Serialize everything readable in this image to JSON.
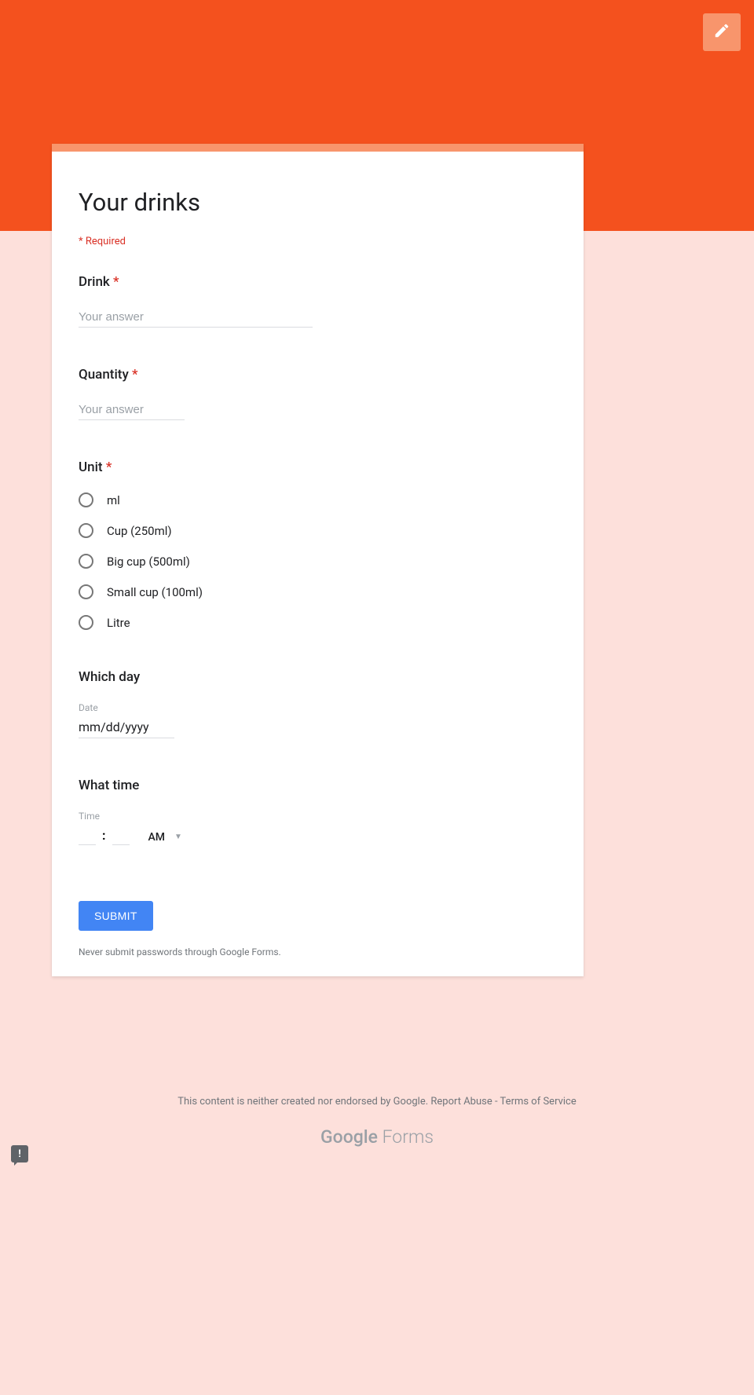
{
  "form": {
    "title": "Your drinks",
    "required_legend": "* Required",
    "questions": {
      "drink": {
        "label": "Drink",
        "placeholder": "Your answer",
        "required": "*"
      },
      "quantity": {
        "label": "Quantity",
        "placeholder": "Your answer",
        "required": "*"
      },
      "unit": {
        "label": "Unit",
        "required": "*",
        "options": [
          "ml",
          "Cup (250ml)",
          "Big cup (500ml)",
          "Small cup (100ml)",
          "Litre"
        ]
      },
      "day": {
        "label": "Which day",
        "sublabel": "Date",
        "value": "mm/dd/yyyy"
      },
      "time": {
        "label": "What time",
        "sublabel": "Time",
        "ampm": "AM",
        "colon": ":"
      }
    },
    "submit_label": "SUBMIT",
    "password_warning": "Never submit passwords through Google Forms."
  },
  "footer": {
    "disclaimer": "This content is neither created nor endorsed by Google. ",
    "report": "Report Abuse",
    "sep": " - ",
    "tos": "Terms of Service",
    "brand_g": "Google",
    "brand_f": " Forms"
  },
  "feedback_icon": "!"
}
